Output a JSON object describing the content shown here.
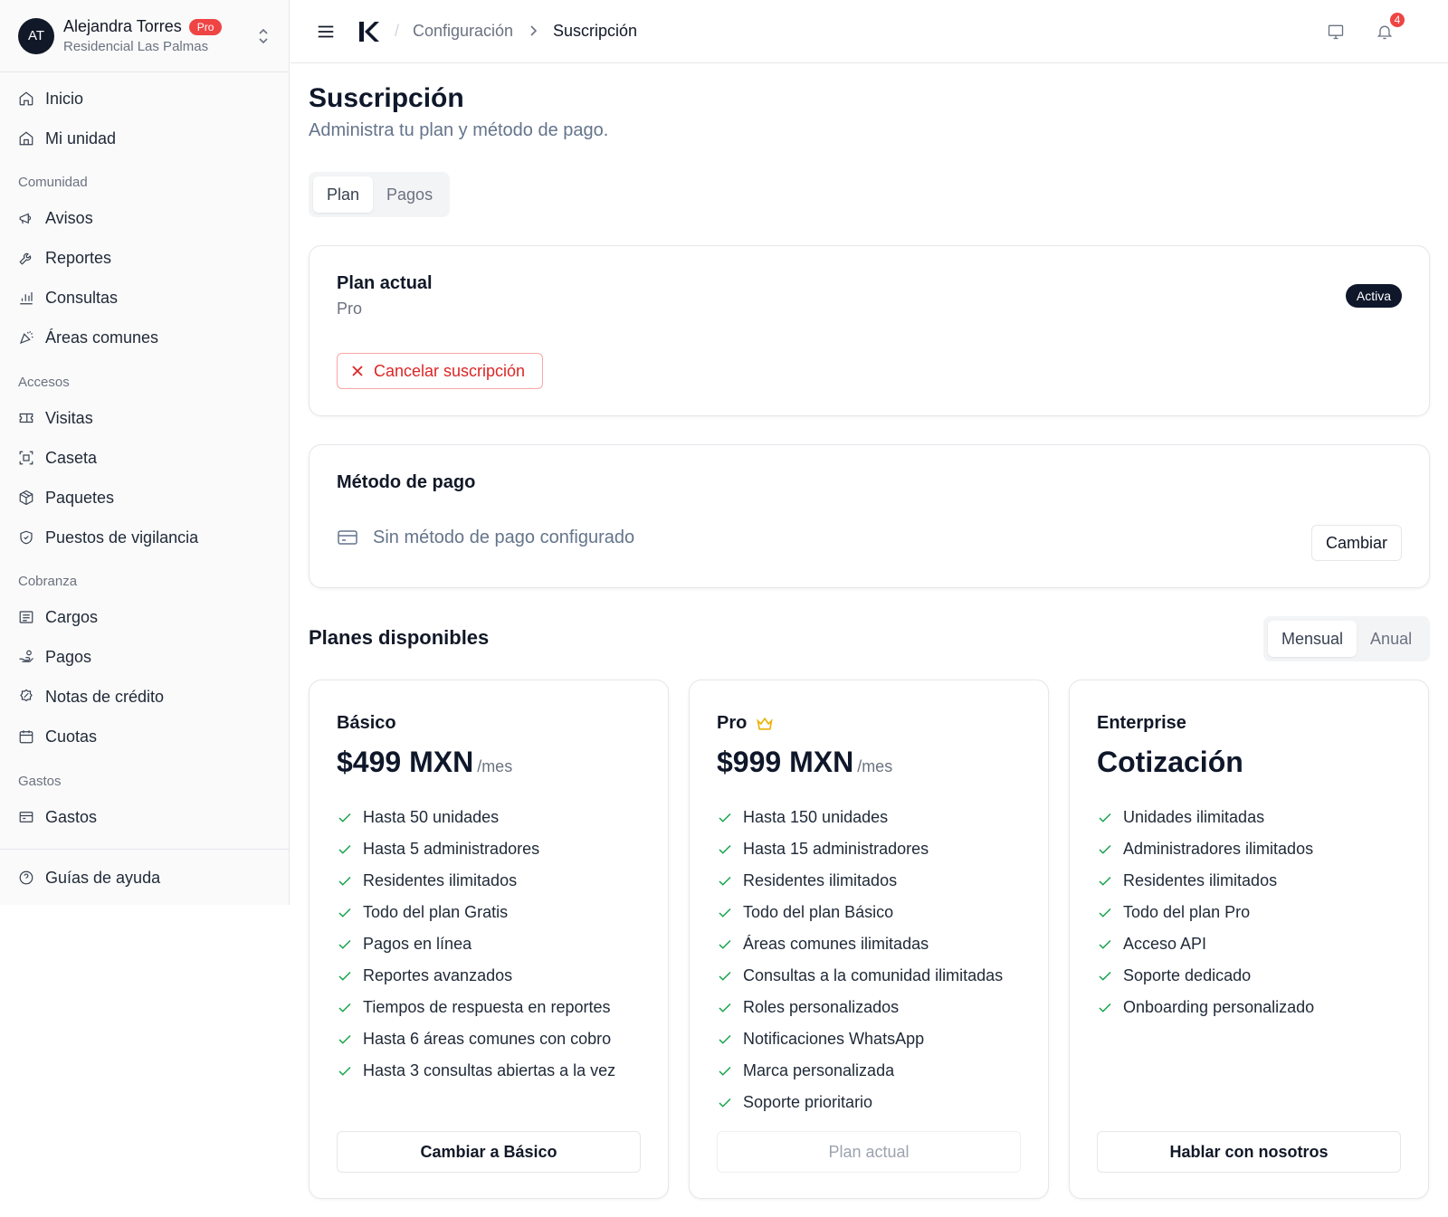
{
  "user": {
    "initials": "AT",
    "name": "Alejandra Torres",
    "badge": "Pro",
    "community": "Residencial Las Palmas"
  },
  "nav": {
    "top": [
      {
        "label": "Inicio",
        "icon": "home-icon"
      },
      {
        "label": "Mi unidad",
        "icon": "unit-icon"
      }
    ],
    "sections": [
      {
        "title": "Comunidad",
        "items": [
          {
            "label": "Avisos",
            "icon": "megaphone-icon"
          },
          {
            "label": "Reportes",
            "icon": "wrench-icon"
          },
          {
            "label": "Consultas",
            "icon": "chart-icon"
          },
          {
            "label": "Áreas comunes",
            "icon": "party-icon"
          }
        ]
      },
      {
        "title": "Accesos",
        "items": [
          {
            "label": "Visitas",
            "icon": "ticket-icon"
          },
          {
            "label": "Caseta",
            "icon": "scan-icon"
          },
          {
            "label": "Paquetes",
            "icon": "package-icon"
          },
          {
            "label": "Puestos de vigilancia",
            "icon": "shield-icon"
          }
        ]
      },
      {
        "title": "Cobranza",
        "items": [
          {
            "label": "Cargos",
            "icon": "receipt-icon"
          },
          {
            "label": "Pagos",
            "icon": "hand-coins-icon"
          },
          {
            "label": "Notas de crédito",
            "icon": "badge-percent-icon"
          },
          {
            "label": "Cuotas",
            "icon": "calendar-icon"
          }
        ]
      },
      {
        "title": "Gastos",
        "items": [
          {
            "label": "Gastos",
            "icon": "wallet-icon"
          }
        ]
      }
    ],
    "help": {
      "label": "Guías de ayuda",
      "icon": "help-circle-icon"
    }
  },
  "topbar": {
    "breadcrumb": [
      "Configuración",
      "Suscripción"
    ],
    "notifications": "4"
  },
  "page": {
    "title": "Suscripción",
    "subtitle": "Administra tu plan y método de pago.",
    "tabs": [
      "Plan",
      "Pagos"
    ]
  },
  "current_plan": {
    "title": "Plan actual",
    "plan": "Pro",
    "status": "Activa",
    "cancel_label": "Cancelar suscripción"
  },
  "payment_method": {
    "title": "Método de pago",
    "empty_text": "Sin método de pago configurado",
    "change_label": "Cambiar"
  },
  "plans_section": {
    "title": "Planes disponibles",
    "billing_options": [
      "Mensual",
      "Anual"
    ],
    "selected": "Mensual"
  },
  "plans": [
    {
      "name": "Básico",
      "price": "$499 MXN",
      "period": "/mes",
      "features": [
        "Hasta 50 unidades",
        "Hasta 5 administradores",
        "Residentes ilimitados",
        "Todo del plan Gratis",
        "Pagos en línea",
        "Reportes avanzados",
        "Tiempos de respuesta en reportes",
        "Hasta 6 áreas comunes con cobro",
        "Hasta 3 consultas abiertas a la vez"
      ],
      "button": "Cambiar a Básico"
    },
    {
      "name": "Pro",
      "price": "$999 MXN",
      "period": "/mes",
      "features": [
        "Hasta 150 unidades",
        "Hasta 15 administradores",
        "Residentes ilimitados",
        "Todo del plan Básico",
        "Áreas comunes ilimitadas",
        "Consultas a la comunidad ilimitadas",
        "Roles personalizados",
        "Notificaciones WhatsApp",
        "Marca personalizada",
        "Soporte prioritario"
      ],
      "button": "Plan actual"
    },
    {
      "name": "Enterprise",
      "price": "Cotización",
      "period": "",
      "features": [
        "Unidades ilimitadas",
        "Administradores ilimitados",
        "Residentes ilimitados",
        "Todo del plan Pro",
        "Acceso API",
        "Soporte dedicado",
        "Onboarding personalizado"
      ],
      "button": "Hablar con nosotros"
    }
  ],
  "colors": {
    "accent": "#0f172a",
    "danger": "#dc2626",
    "success": "#16a34a",
    "badge": "#ef4444"
  }
}
